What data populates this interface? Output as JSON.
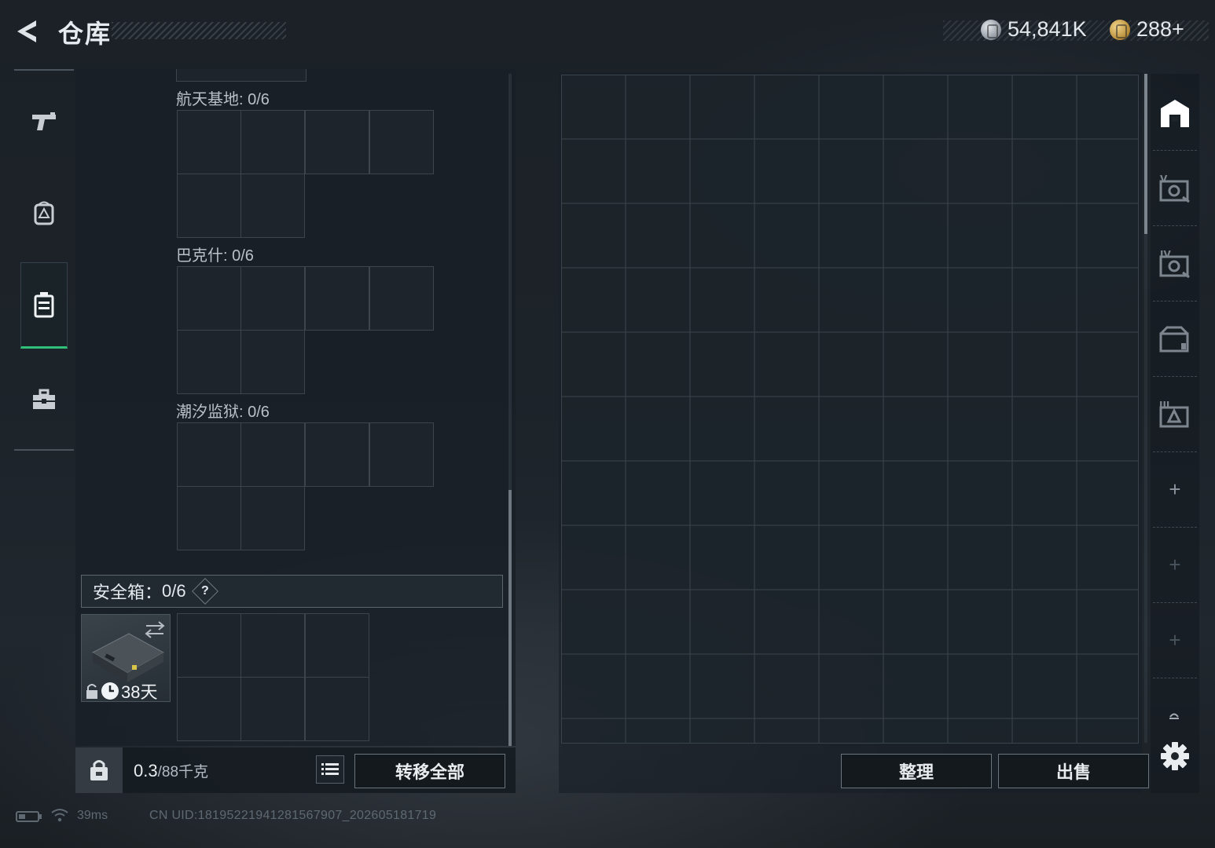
{
  "header": {
    "title": "仓库",
    "currencies": [
      {
        "name": "silver-coin",
        "value": "54,841K"
      },
      {
        "name": "gold-coin",
        "value": "288+"
      }
    ]
  },
  "left_nav": {
    "items": [
      {
        "id": "weapons",
        "icon": "pistol-icon",
        "active": false
      },
      {
        "id": "backpack",
        "icon": "backpack-icon",
        "active": false
      },
      {
        "id": "vest",
        "icon": "chest-rig-icon",
        "active": true
      },
      {
        "id": "toolbox",
        "icon": "briefcase-icon",
        "active": false
      }
    ]
  },
  "containers": [
    {
      "label": "航天基地: 0/6"
    },
    {
      "label": "巴克什: 0/6"
    },
    {
      "label": "潮汐监狱: 0/6"
    }
  ],
  "safe_box": {
    "label": "安全箱：",
    "capacity": "0/6",
    "help": "?",
    "duration": "38天"
  },
  "weight": {
    "current": "0.3",
    "max": "/88千克"
  },
  "buttons": {
    "transfer_all": "转移全部",
    "organize": "整理",
    "sell": "出售"
  },
  "right_tabs": [
    {
      "icon": "warehouse-icon",
      "active": true
    },
    {
      "icon": "storage-v-icon",
      "roman": "V"
    },
    {
      "icon": "storage-iv-icon",
      "roman": "IV"
    },
    {
      "icon": "storage-crate-icon"
    },
    {
      "icon": "storage-iii-icon",
      "roman": "III"
    },
    {
      "icon": "add-icon"
    },
    {
      "icon": "add-icon",
      "dim": true
    },
    {
      "icon": "add-icon",
      "dim": true
    },
    {
      "icon": "collapse-icon"
    }
  ],
  "status": {
    "ping": "39ms",
    "uid": "CN UID:18195221941281567907_202605181719"
  },
  "colors": {
    "accent_green": "#2fbf79",
    "panel_bg": "#181f26",
    "grid_line": "#3c454d"
  }
}
